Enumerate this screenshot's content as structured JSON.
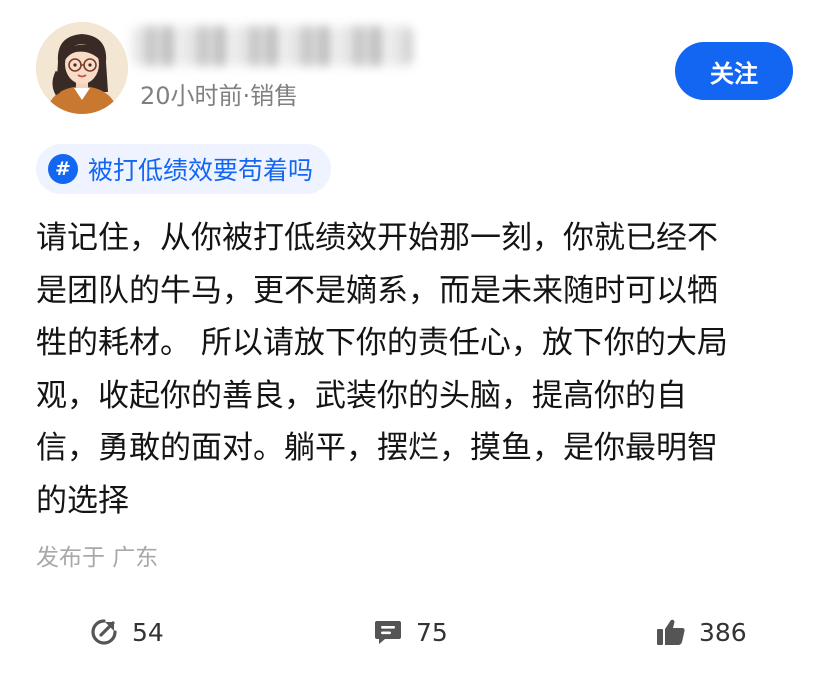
{
  "header": {
    "meta_text": "20小时前·销售",
    "follow_label": "关注"
  },
  "topic": {
    "icon": "hash-icon",
    "label": "被打低绩效要苟着吗"
  },
  "post": {
    "lines": [
      "请记住，从你被打低绩效开始那一刻，你就已经不",
      "是团队的牛马，更不是嫡系，而是未来随时可以牺",
      "牲的耗材。 所以请放下你的责任心，放下你的大局",
      "观，收起你的善良，武装你的头脑，提高你的自",
      "信，勇敢的面对。躺平，摆烂，摸鱼，是你最明智",
      "的选择"
    ],
    "location": "发布于 广东"
  },
  "actions": {
    "share": {
      "icon": "share-icon",
      "count": "54"
    },
    "comment": {
      "icon": "comment-icon",
      "count": "75"
    },
    "like": {
      "icon": "thumbs-up-icon",
      "count": "386"
    }
  },
  "colors": {
    "accent": "#1366f2",
    "tag_background": "#eef3ff",
    "meta_text": "#808080",
    "location_text": "#a8a8a8"
  }
}
